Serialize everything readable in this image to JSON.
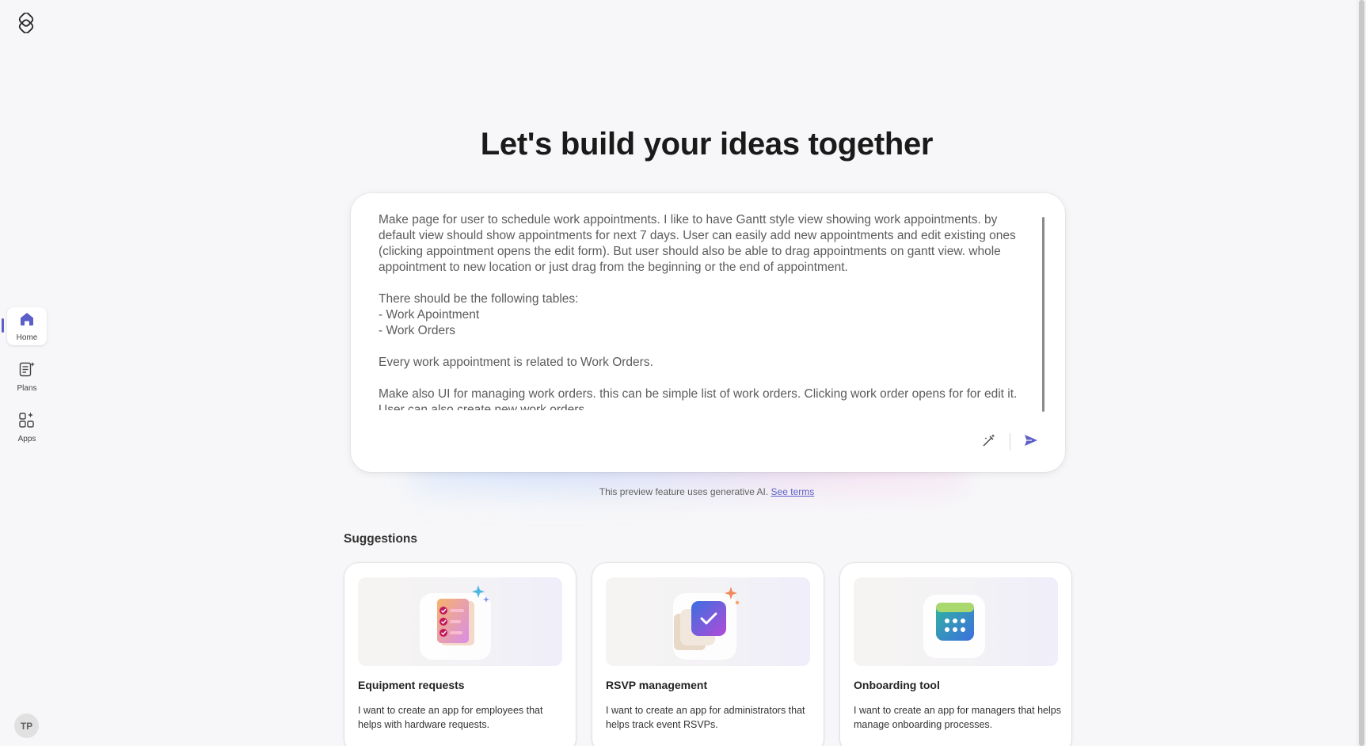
{
  "app": {
    "logo_icon": "app-logo-icon"
  },
  "rail": {
    "items": [
      {
        "label": "Home",
        "icon": "home-icon",
        "active": true
      },
      {
        "label": "Plans",
        "icon": "plans-icon",
        "active": false
      },
      {
        "label": "Apps",
        "icon": "apps-icon",
        "active": false
      }
    ],
    "avatar_initials": "TP"
  },
  "main": {
    "title": "Let's build your ideas together",
    "prompt": {
      "value": "Make page for user to schedule work appointments. I like to have Gantt style view showing work appointments. by default view should show appointments for next 7 days. User can easily add new appointments and edit existing ones (clicking appointment opens the edit form). But user should also be able to drag appointments on gantt view. whole appointment to new location or just drag from the beginning or the end of appointment.\n\nThere should be the following tables:\n- Work Apointment\n- Work Orders\n\nEvery work appointment is related to Work Orders.\n\nMake also UI for managing work orders. this can be simple list of work orders. Clicking work order opens for for edit it. User can also create new work orders."
    },
    "disclaimer": {
      "text": "This preview feature uses generative AI. ",
      "link": "See terms"
    }
  },
  "suggestions": {
    "heading": "Suggestions",
    "cards": [
      {
        "title": "Equipment requests",
        "description": "I want to create an app for employees that helps with hardware requests.",
        "icon": "checklist-illustration"
      },
      {
        "title": "RSVP management",
        "description": "I want to create an app for administrators that helps track event RSVPs.",
        "icon": "rsvp-check-illustration"
      },
      {
        "title": "Onboarding tool",
        "description": "I want to create an app for managers that helps manage onboarding processes.",
        "icon": "calendar-illustration"
      }
    ]
  },
  "colors": {
    "accent": "#5b5fc7",
    "background": "#f7f7f9"
  }
}
